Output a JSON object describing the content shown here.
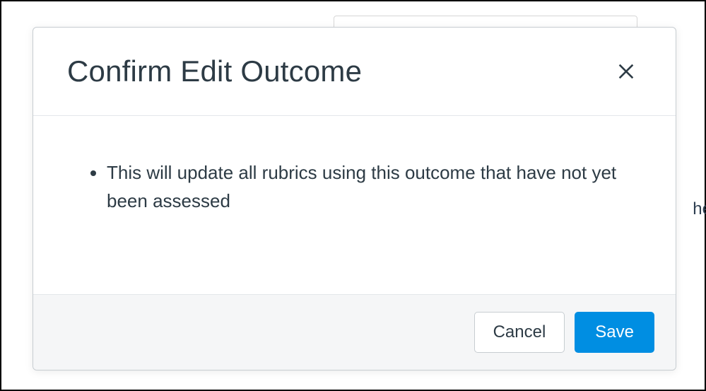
{
  "modal": {
    "title": "Confirm Edit Outcome",
    "body": {
      "items": [
        "This will update all rubrics using this outcome that have not yet been assessed"
      ]
    },
    "footer": {
      "cancel_label": "Cancel",
      "save_label": "Save"
    }
  },
  "background": {
    "partial_text": "he"
  },
  "colors": {
    "primary": "#008ee2",
    "text": "#2d3b45",
    "border": "#c7cdd1",
    "footer_bg": "#f5f6f7"
  }
}
